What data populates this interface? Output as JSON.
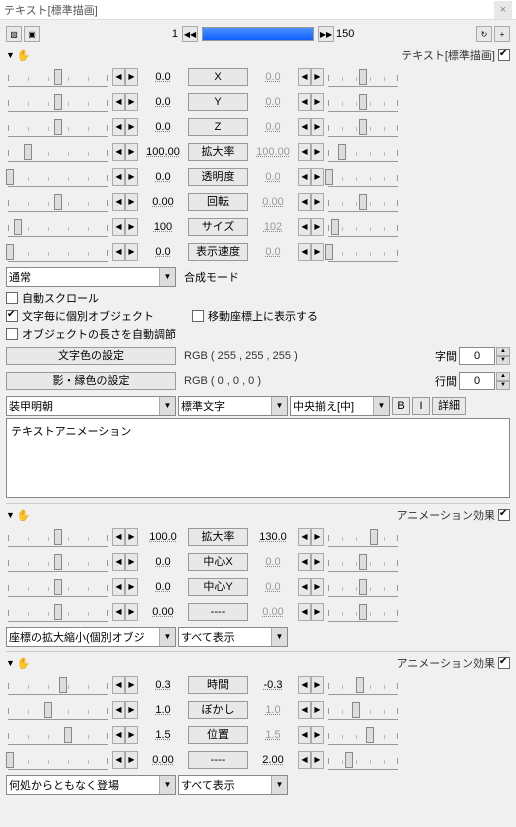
{
  "title": "テキスト[標準描画]",
  "timeline": {
    "start": "1",
    "end": "150"
  },
  "section1": {
    "label": "テキスト[標準描画]",
    "params": [
      {
        "name": "X",
        "lval": "0.0",
        "rval": "0.0",
        "rdim": true,
        "lpos": 50,
        "rpos": 50
      },
      {
        "name": "Y",
        "lval": "0.0",
        "rval": "0.0",
        "rdim": true,
        "lpos": 50,
        "rpos": 50
      },
      {
        "name": "Z",
        "lval": "0.0",
        "rval": "0.0",
        "rdim": true,
        "lpos": 50,
        "rpos": 50
      },
      {
        "name": "拡大率",
        "lval": "100.00",
        "rval": "100.00",
        "rdim": true,
        "lpos": 20,
        "rpos": 20
      },
      {
        "name": "透明度",
        "lval": "0.0",
        "rval": "0.0",
        "rdim": true,
        "lpos": 2,
        "rpos": 2
      },
      {
        "name": "回転",
        "lval": "0.00",
        "rval": "0.00",
        "rdim": true,
        "lpos": 50,
        "rpos": 50
      },
      {
        "name": "サイズ",
        "lval": "100",
        "rval": "102",
        "rdim": true,
        "lpos": 10,
        "rpos": 10
      },
      {
        "name": "表示速度",
        "lval": "0.0",
        "rval": "0.0",
        "rdim": true,
        "lpos": 2,
        "rpos": 2
      }
    ],
    "blendLabel": "合成モード",
    "blendValue": "通常",
    "checks": {
      "autoScroll": "自動スクロール",
      "perChar": "文字毎に個別オブジェクト",
      "onMove": "移動座標上に表示する",
      "autoLen": "オブジェクトの長さを自動調節"
    },
    "textColorBtn": "文字色の設定",
    "textColorRgb": "RGB ( 255 , 255 , 255 )",
    "shadowBtn": "影・縁色の設定",
    "shadowRgb": "RGB ( 0 , 0 , 0 )",
    "spacingLabel": "字間",
    "spacingVal": "0",
    "lineLabel": "行間",
    "lineVal": "0",
    "font": "装甲明朝",
    "charType": "標準文字",
    "align": "中央揃え[中]",
    "bold": "B",
    "italic": "I",
    "detail": "詳細",
    "textContent": "テキストアニメーション"
  },
  "section2": {
    "label": "アニメーション効果",
    "params": [
      {
        "name": "拡大率",
        "lval": "100.0",
        "rval": "130.0",
        "lpos": 50,
        "rpos": 65
      },
      {
        "name": "中心X",
        "lval": "0.0",
        "rval": "0.0",
        "rdim": true,
        "lpos": 50,
        "rpos": 50
      },
      {
        "name": "中心Y",
        "lval": "0.0",
        "rval": "0.0",
        "rdim": true,
        "lpos": 50,
        "rpos": 50
      },
      {
        "name": "----",
        "lval": "0.00",
        "rval": "0.00",
        "rdim": true,
        "lpos": 50,
        "rpos": 50
      }
    ],
    "effect": "座標の拡大縮小(個別オブジ",
    "show": "すべて表示"
  },
  "section3": {
    "label": "アニメーション効果",
    "params": [
      {
        "name": "時間",
        "lval": "0.3",
        "rval": "-0.3",
        "lpos": 55,
        "rpos": 45
      },
      {
        "name": "ぼかし",
        "lval": "1.0",
        "rval": "1.0",
        "rdim": true,
        "lpos": 40,
        "rpos": 40
      },
      {
        "name": "位置",
        "lval": "1.5",
        "rval": "1.5",
        "rdim": true,
        "lpos": 60,
        "rpos": 60
      },
      {
        "name": "----",
        "lval": "0.00",
        "rval": "2.00",
        "lpos": 2,
        "rpos": 30
      }
    ],
    "effect": "何処からともなく登場",
    "show": "すべて表示"
  }
}
